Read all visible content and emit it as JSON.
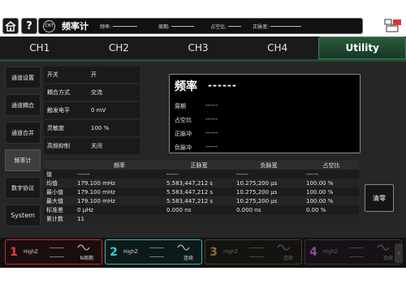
{
  "topbar": {
    "home_icon": "home-icon",
    "help_label": "?",
    "counter_badge": "CNT",
    "title": "频率计",
    "freq_label": "频率:",
    "period_label": "周期:",
    "duty_label": "占空比:",
    "pos_width_label": "正脉宽:"
  },
  "tabs": [
    {
      "label": "CH1"
    },
    {
      "label": "CH2"
    },
    {
      "label": "CH3"
    },
    {
      "label": "CH4"
    },
    {
      "label": "Utility",
      "active": true
    }
  ],
  "sidebar": {
    "items": [
      {
        "label": "通道设置"
      },
      {
        "label": "通道耦合"
      },
      {
        "label": "通道合并"
      },
      {
        "label": "频率计",
        "active": true
      },
      {
        "label": "数字协议"
      },
      {
        "label": "System"
      }
    ]
  },
  "settings": [
    {
      "key": "开关",
      "value": "开"
    },
    {
      "key": "耦合方式",
      "value": "交流"
    },
    {
      "key": "触发电平",
      "value": "0 mV"
    },
    {
      "key": "灵敏度",
      "value": "100 %"
    },
    {
      "key": "高频抑制",
      "value": "关闭"
    }
  ],
  "display": {
    "title": "频率",
    "title_value": "------",
    "rows": [
      {
        "key": "周期",
        "value": "------"
      },
      {
        "key": "占空比",
        "value": "------"
      },
      {
        "key": "正脉冲",
        "value": "------"
      },
      {
        "key": "负脉冲",
        "value": "------"
      }
    ]
  },
  "stats": {
    "headers": [
      "",
      "频率",
      "正脉宽",
      "负脉宽",
      "占空比"
    ],
    "rows": [
      {
        "label": "值",
        "cells": [
          "------",
          "------",
          "------",
          "------"
        ]
      },
      {
        "label": "均值",
        "cells": [
          "179.100 mHz",
          "5.583,447,212 s",
          "10.275,200 μs",
          "100.00 %"
        ]
      },
      {
        "label": "最小值",
        "cells": [
          "179.100 mHz",
          "5.583,447,212 s",
          "10.275,200 μs",
          "100.00 %"
        ]
      },
      {
        "label": "最大值",
        "cells": [
          "179.100 mHz",
          "5.583,447,212 s",
          "10.275,200 μs",
          "100.00 %"
        ]
      },
      {
        "label": "标准差",
        "cells": [
          "0 μHz",
          "0.000 ns",
          "0.000 ns",
          "0.00 %"
        ]
      },
      {
        "label": "累计数",
        "cells": [
          "11",
          "",
          "",
          ""
        ]
      }
    ]
  },
  "clear_label": "清零",
  "channels": [
    {
      "num": "1",
      "impedance": "HighZ",
      "mode": "N周期",
      "color": "#cc2b2b"
    },
    {
      "num": "2",
      "impedance": "HighZ",
      "mode": "连续",
      "color": "#2fb7b7"
    },
    {
      "num": "3",
      "impedance": "HighZ",
      "mode": "连续",
      "color": "#8a6a35"
    },
    {
      "num": "4",
      "impedance": "HighZ",
      "mode": "连续",
      "color": "#8e4a8e"
    }
  ]
}
